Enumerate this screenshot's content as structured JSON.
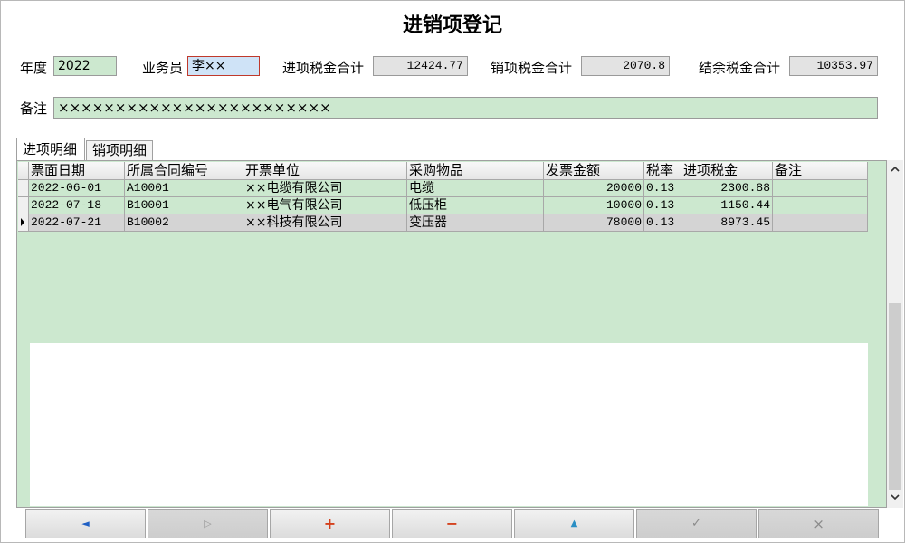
{
  "window": {
    "title": "进销项登记"
  },
  "form": {
    "year_label": "年度",
    "year_value": "2022",
    "salesperson_label": "业务员",
    "salesperson_value": "李××",
    "input_tax_label": "进项税金合计",
    "input_tax_value": "12424.77",
    "output_tax_label": "销项税金合计",
    "output_tax_value": "2070.8",
    "balance_tax_label": "结余税金合计",
    "balance_tax_value": "10353.97",
    "note_label": "备注",
    "note_value": "××××××××××××××××××××××××"
  },
  "tabs": [
    {
      "label": "进项明细",
      "active": true
    },
    {
      "label": "销项明细",
      "active": false
    }
  ],
  "grid": {
    "columns": [
      "票面日期",
      "所属合同编号",
      "开票单位",
      "采购物品",
      "发票金额",
      "税率",
      "进项税金",
      "备注"
    ],
    "rows": [
      {
        "date": "2022-06-01",
        "contract": "A10001",
        "issuer": "××电缆有限公司",
        "item": "电缆",
        "amount": "20000",
        "rate": "0.13",
        "tax": "2300.88",
        "note": "",
        "selected": false
      },
      {
        "date": "2022-07-18",
        "contract": "B10001",
        "issuer": "××电气有限公司",
        "item": "低压柜",
        "amount": "10000",
        "rate": "0.13",
        "tax": "1150.44",
        "note": "",
        "selected": false
      },
      {
        "date": "2022-07-21",
        "contract": "B10002",
        "issuer": "××科技有限公司",
        "item": "变压器",
        "amount": "78000",
        "rate": "0.13",
        "tax": "8973.45",
        "note": "",
        "selected": true
      }
    ]
  },
  "navigator": {
    "buttons": [
      {
        "name": "prior-record-button",
        "icon": "triangle-left-icon",
        "glyph": "◄",
        "color": "#1f5fc4",
        "enabled": true
      },
      {
        "name": "next-record-button",
        "icon": "triangle-right-icon",
        "glyph": "▷",
        "color": "#9a9a9a",
        "enabled": false
      },
      {
        "name": "insert-record-button",
        "icon": "plus-icon",
        "glyph": "+",
        "color": "#d4401c",
        "enabled": true
      },
      {
        "name": "delete-record-button",
        "icon": "minus-icon",
        "glyph": "−",
        "color": "#d4401c",
        "enabled": true
      },
      {
        "name": "edit-record-button",
        "icon": "triangle-up-icon",
        "glyph": "▲",
        "color": "#2a8fc4",
        "enabled": true
      },
      {
        "name": "post-record-button",
        "icon": "check-icon",
        "glyph": "✓",
        "color": "#8a8a8a",
        "enabled": false
      },
      {
        "name": "cancel-record-button",
        "icon": "cross-icon",
        "glyph": "×",
        "color": "#8a8a8a",
        "enabled": false
      }
    ]
  }
}
